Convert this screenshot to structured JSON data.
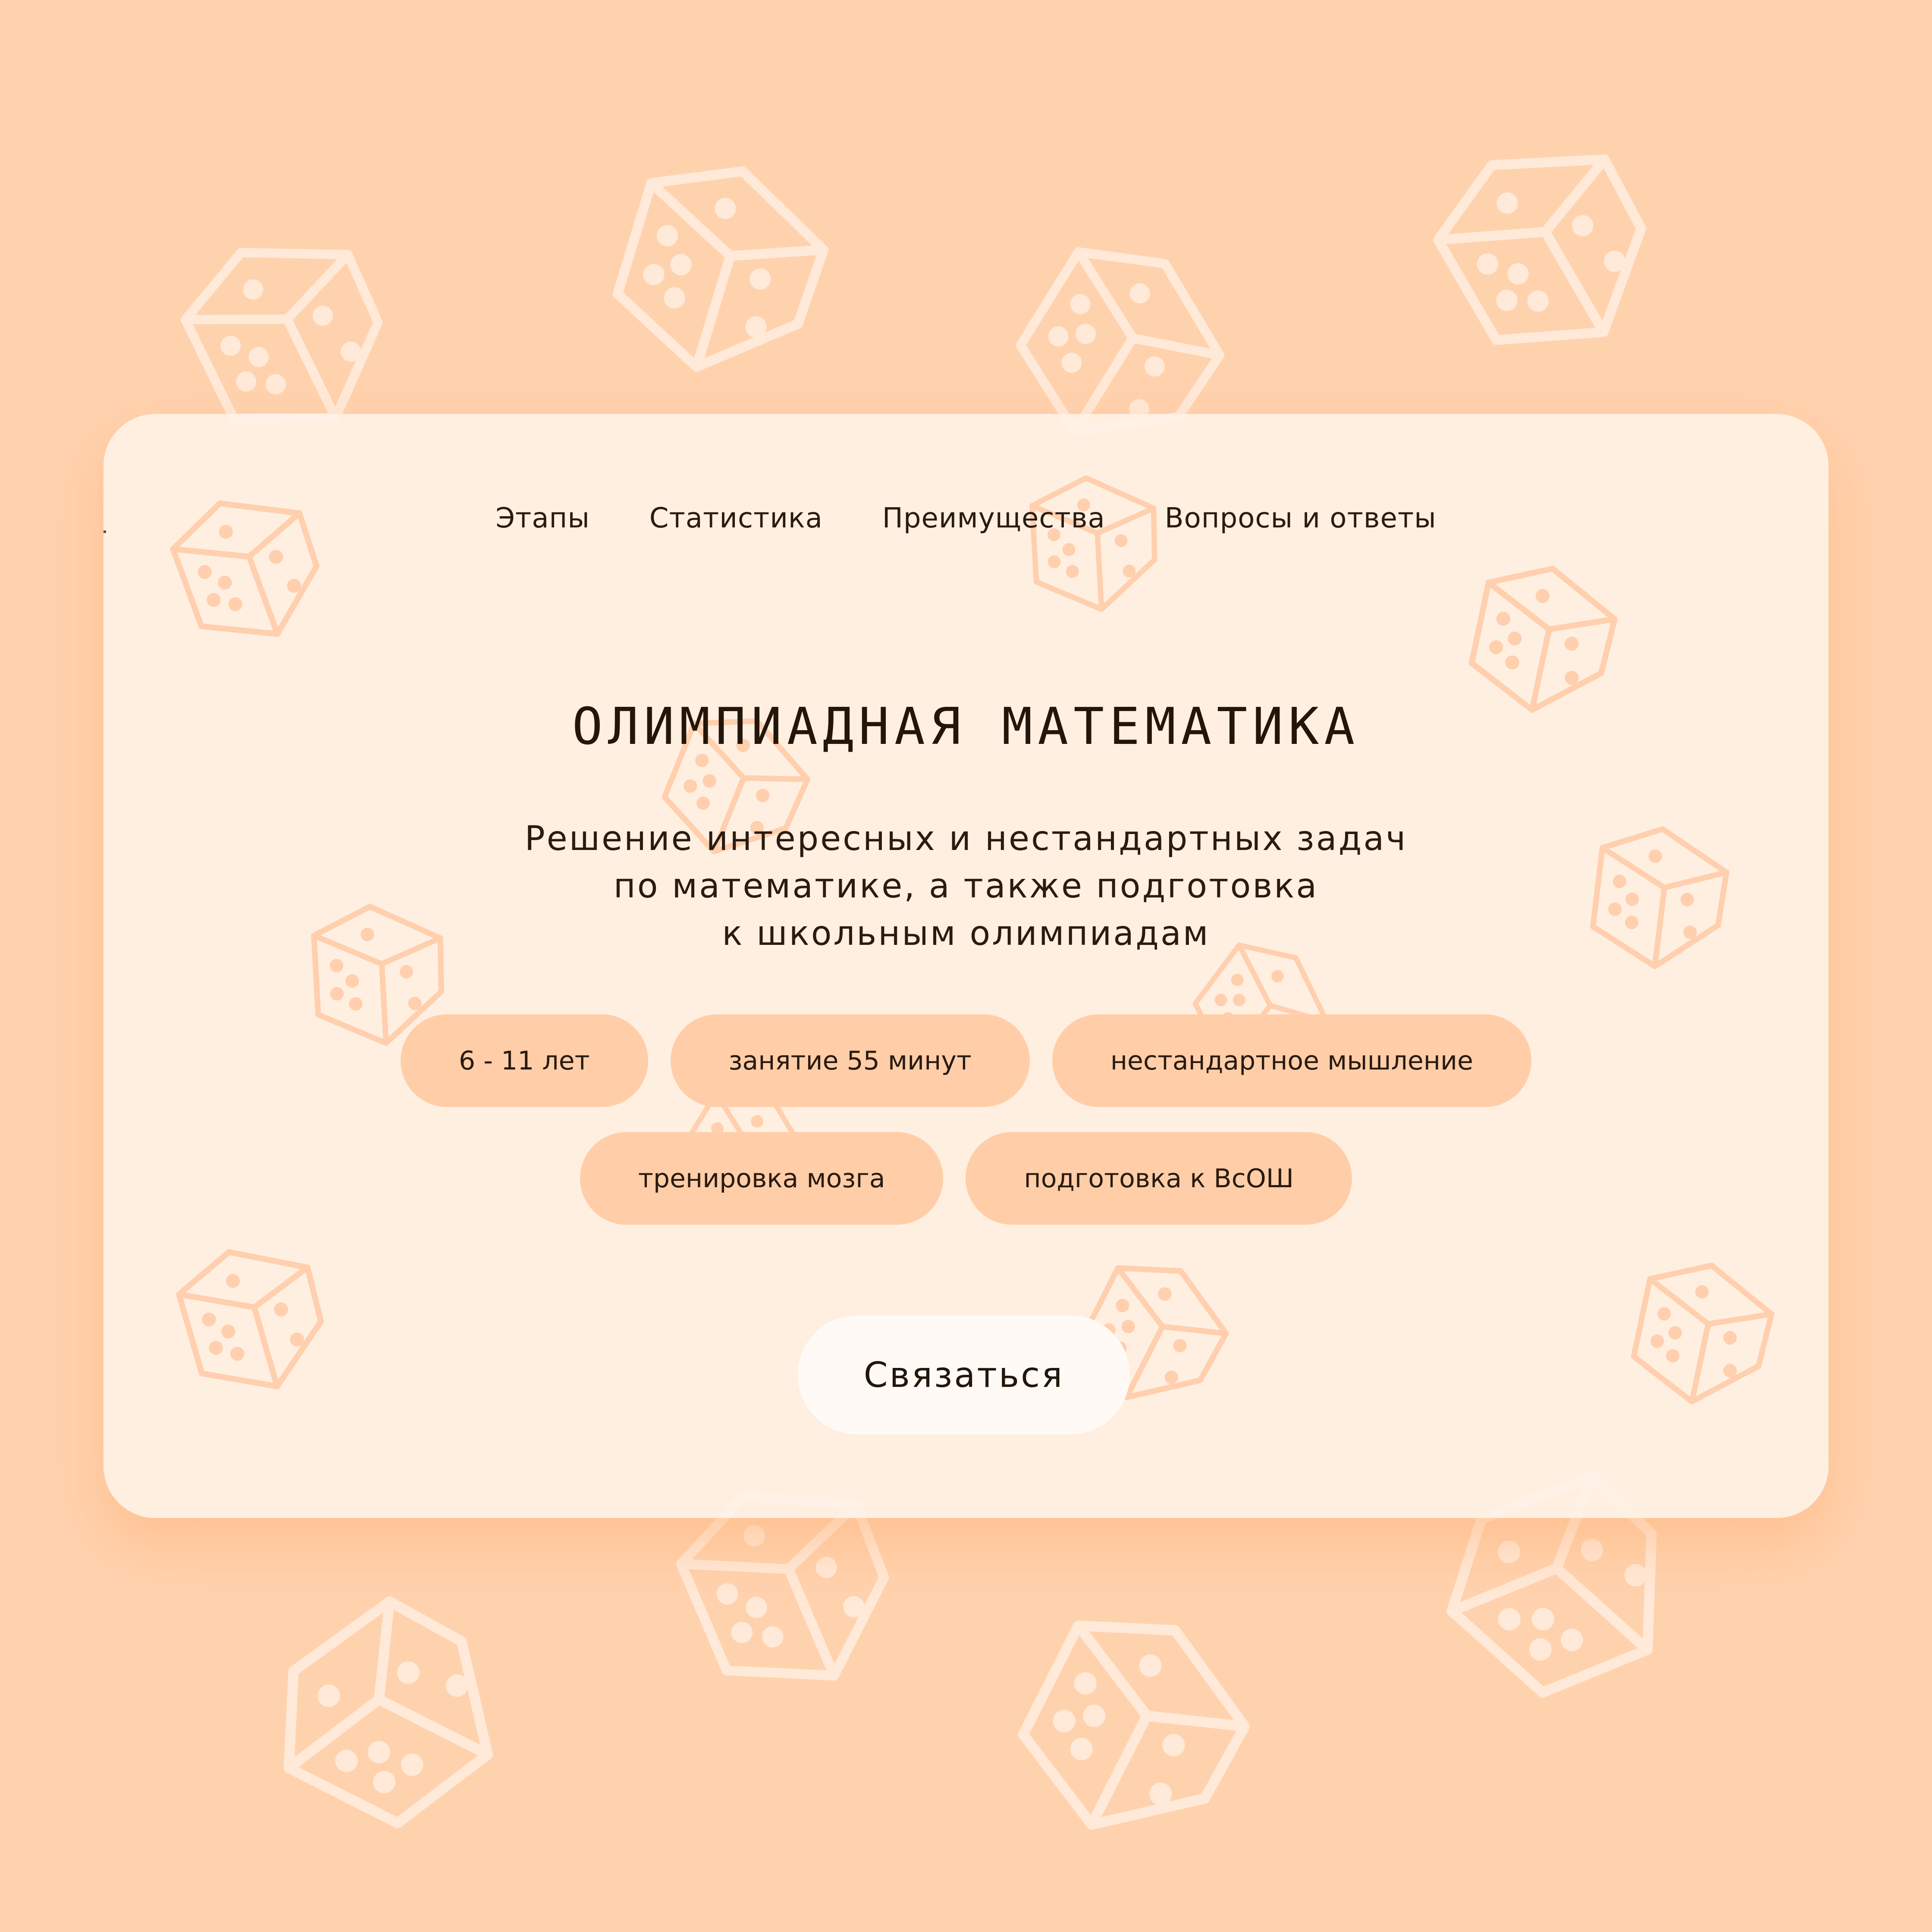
{
  "nav": {
    "items": [
      {
        "label": "Этапы"
      },
      {
        "label": "Статистика"
      },
      {
        "label": "Преимущества"
      },
      {
        "label": "Вопросы и ответы"
      }
    ]
  },
  "hero": {
    "title": "ОЛИМПИАДНАЯ МАТЕМАТИКА",
    "subtitle_lines": [
      "Решение интересных и нестандартных задач",
      "по математике, а также подготовка",
      "к школьным олимпиадам"
    ]
  },
  "tags": {
    "row1": [
      {
        "label": "6 - 11 лет"
      },
      {
        "label": "занятие 55 минут"
      },
      {
        "label": "нестандартное мышление"
      }
    ],
    "row2": [
      {
        "label": "тренировка мозга"
      },
      {
        "label": "подготовка к ВсОШ"
      }
    ]
  },
  "cta": {
    "label": "Связаться"
  },
  "decor": {
    "pattern_icon": "dice-icon"
  },
  "colors": {
    "background": "#FFD2AE",
    "card": "#FFF1E5",
    "tag": "#FFCEA8",
    "button": "#FFFAF6",
    "text": "#231509",
    "dice_outline_bg": "#FFE9D8",
    "dice_outline_card": "#FFCFAE"
  }
}
